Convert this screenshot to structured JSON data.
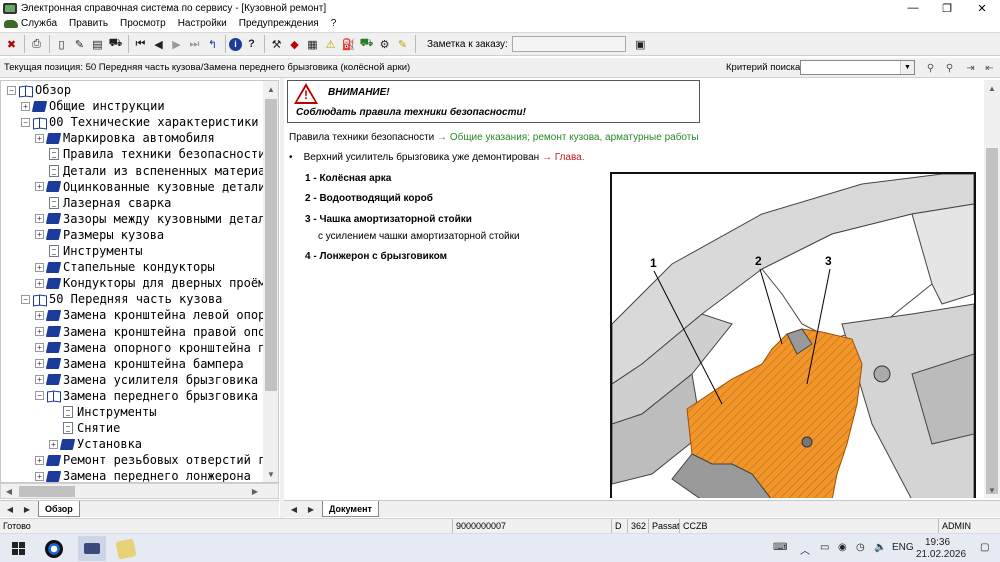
{
  "window": {
    "title": "Электронная справочная система по сервису - [Кузовной ремонт]"
  },
  "menu": [
    "Служба",
    "Править",
    "Просмотр",
    "Настройки",
    "Предупреждения",
    "?"
  ],
  "toolbar": {
    "note_label": "Заметка к заказу:",
    "note_value": ""
  },
  "position": {
    "text": "Текущая позиция: 50 Передняя часть кузова/Замена переднего брызговика (колёсной арки)"
  },
  "search": {
    "label": "Критерий поиска:",
    "value": ""
  },
  "tree": {
    "items": [
      {
        "label": "Обзор",
        "level": 0,
        "expander": "−",
        "icon": "book-open"
      },
      {
        "label": "Общие инструкции",
        "level": 1,
        "expander": "+",
        "icon": "book-closed"
      },
      {
        "label": "00 Технические характеристики",
        "level": 1,
        "expander": "−",
        "icon": "book-open"
      },
      {
        "label": "Маркировка автомобиля",
        "level": 2,
        "expander": "+",
        "icon": "book-closed"
      },
      {
        "label": "Правила техники безопасности",
        "level": 2,
        "expander": "",
        "icon": "document"
      },
      {
        "label": "Детали из вспененных материалов",
        "level": 2,
        "expander": "",
        "icon": "document"
      },
      {
        "label": "Оцинкованные кузовные детали",
        "level": 2,
        "expander": "+",
        "icon": "book-closed"
      },
      {
        "label": "Лазерная сварка",
        "level": 2,
        "expander": "",
        "icon": "document"
      },
      {
        "label": "Зазоры между кузовными деталями",
        "level": 2,
        "expander": "+",
        "icon": "book-closed"
      },
      {
        "label": "Размеры кузова",
        "level": 2,
        "expander": "+",
        "icon": "book-closed"
      },
      {
        "label": "Инструменты",
        "level": 2,
        "expander": "",
        "icon": "document"
      },
      {
        "label": "Стапельные кондукторы",
        "level": 2,
        "expander": "+",
        "icon": "book-closed"
      },
      {
        "label": "Кондукторы для дверных проёмов",
        "level": 2,
        "expander": "+",
        "icon": "book-closed"
      },
      {
        "label": "50 Передняя часть кузова",
        "level": 1,
        "expander": "−",
        "icon": "book-open"
      },
      {
        "label": "Замена кронштейна левой опоры",
        "level": 2,
        "expander": "+",
        "icon": "book-closed"
      },
      {
        "label": "Замена кронштейна правой опоры",
        "level": 2,
        "expander": "+",
        "icon": "book-closed"
      },
      {
        "label": "Замена опорного кронштейна п",
        "level": 2,
        "expander": "+",
        "icon": "book-closed"
      },
      {
        "label": "Замена кронштейна бампера",
        "level": 2,
        "expander": "+",
        "icon": "book-closed"
      },
      {
        "label": "Замена усилителя брызговика",
        "level": 2,
        "expander": "+",
        "icon": "book-closed"
      },
      {
        "label": "Замена переднего брызговика",
        "level": 2,
        "expander": "−",
        "icon": "book-open"
      },
      {
        "label": "Инструменты",
        "level": 3,
        "expander": "",
        "icon": "document"
      },
      {
        "label": "Снятие",
        "level": 3,
        "expander": "",
        "icon": "document"
      },
      {
        "label": "Установка",
        "level": 3,
        "expander": "+",
        "icon": "book-closed"
      },
      {
        "label": "Ремонт резьбовых отверстий г",
        "level": 2,
        "expander": "+",
        "icon": "book-closed"
      },
      {
        "label": "Замена переднего лонжерона",
        "level": 2,
        "expander": "+",
        "icon": "book-closed"
      }
    ]
  },
  "left_tab": {
    "label": "Обзор"
  },
  "right_tab": {
    "label": "Документ"
  },
  "document": {
    "warning_title": "ВНИМАНИЕ!",
    "warning_text": "Соблюдать правила техники безопасности!",
    "safety_prefix": "Правила техники безопасности",
    "safety_link": "→ Общие указания; ремонт кузова, арматурные работы",
    "bullet_text": "Верхний усилитель брызговика уже демонтирован",
    "bullet_link": "→ Глава.",
    "legend": [
      {
        "num": "1",
        "label": "Колёсная арка",
        "sub": ""
      },
      {
        "num": "2",
        "label": "Водоотводящий короб",
        "sub": ""
      },
      {
        "num": "3",
        "label": "Чашка амортизаторной стойки",
        "sub": "с усилением чашки амортизаторной стойки"
      },
      {
        "num": "4",
        "label": "Лонжерон с брызговиком",
        "sub": ""
      }
    ],
    "figure_callouts": [
      "1",
      "2",
      "3"
    ],
    "highlight_color": "#f0962a"
  },
  "status": {
    "ready": "Готово",
    "order": "9000000007",
    "d": "D",
    "num": "362",
    "model": "Passat",
    "code": "CCZB",
    "user": "ADMIN"
  },
  "taskbar": {
    "lang": "ENG",
    "time": "19:36",
    "date": "21.02.2026"
  }
}
